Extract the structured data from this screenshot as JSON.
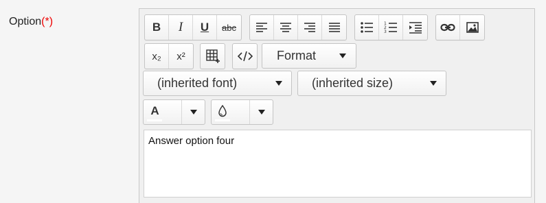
{
  "form": {
    "label": "Option",
    "required_marker": "(*)"
  },
  "toolbar": {
    "format_label": "Format",
    "font_label": "(inherited font)",
    "size_label": "(inherited size)",
    "subscript_glyph": "x₂",
    "superscript_glyph": "x²",
    "text_color_glyph": "A",
    "bold_glyph": "B",
    "italic_glyph": "I",
    "underline_glyph": "U",
    "strike_glyph": "abc"
  },
  "editor": {
    "content": "Answer option four"
  }
}
